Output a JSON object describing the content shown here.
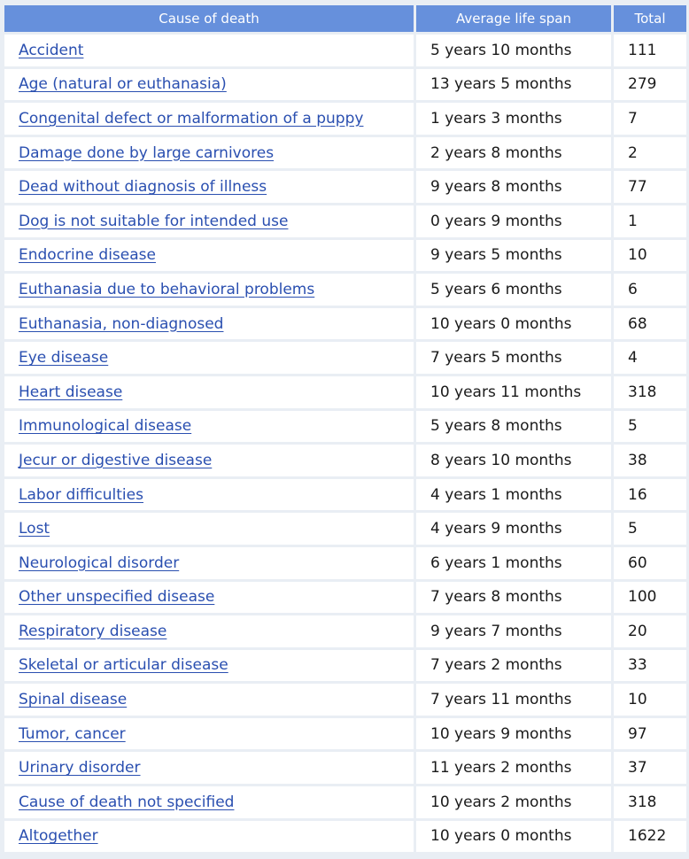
{
  "table": {
    "headers": {
      "cause": "Cause of death",
      "span": "Average life span",
      "total": "Total"
    },
    "rows": [
      {
        "cause": "Accident",
        "span": "5 years 10 months",
        "total": "111"
      },
      {
        "cause": "Age (natural or euthanasia)",
        "span": "13 years 5 months",
        "total": "279"
      },
      {
        "cause": "Congenital defect or malformation of a puppy",
        "span": "1 years 3 months",
        "total": "7"
      },
      {
        "cause": "Damage done by large carnivores",
        "span": "2 years 8 months",
        "total": "2"
      },
      {
        "cause": "Dead without diagnosis of illness",
        "span": "9 years 8 months",
        "total": "77"
      },
      {
        "cause": "Dog is not suitable for intended use",
        "span": "0 years 9 months",
        "total": "1"
      },
      {
        "cause": "Endocrine disease",
        "span": "9 years 5 months",
        "total": "10"
      },
      {
        "cause": "Euthanasia due to behavioral problems",
        "span": "5 years 6 months",
        "total": "6"
      },
      {
        "cause": "Euthanasia, non-diagnosed",
        "span": "10 years 0 months",
        "total": "68"
      },
      {
        "cause": "Eye disease",
        "span": "7 years 5 months",
        "total": "4"
      },
      {
        "cause": "Heart disease",
        "span": "10 years 11 months",
        "total": "318"
      },
      {
        "cause": "Immunological disease",
        "span": "5 years 8 months",
        "total": "5"
      },
      {
        "cause": "Jecur or digestive disease",
        "span": "8 years 10 months",
        "total": "38"
      },
      {
        "cause": "Labor difficulties",
        "span": "4 years 1 months",
        "total": "16"
      },
      {
        "cause": "Lost",
        "span": "4 years 9 months",
        "total": "5"
      },
      {
        "cause": "Neurological disorder",
        "span": "6 years 1 months",
        "total": "60"
      },
      {
        "cause": "Other unspecified disease",
        "span": "7 years 8 months",
        "total": "100"
      },
      {
        "cause": "Respiratory disease",
        "span": "9 years 7 months",
        "total": "20"
      },
      {
        "cause": "Skeletal or articular disease",
        "span": "7 years 2 months",
        "total": "33"
      },
      {
        "cause": "Spinal disease",
        "span": "7 years 11 months",
        "total": "10"
      },
      {
        "cause": "Tumor, cancer",
        "span": "10 years 9 months",
        "total": "97"
      },
      {
        "cause": "Urinary disorder",
        "span": "11 years 2 months",
        "total": "37"
      },
      {
        "cause": "Cause of death not specified",
        "span": "10 years 2 months",
        "total": "318"
      },
      {
        "cause": "Altogether",
        "span": "10 years 0 months",
        "total": "1622"
      }
    ]
  },
  "colors": {
    "header_bg": "#6690dc",
    "page_bg": "#e9eef4",
    "link": "#2a4fb0"
  }
}
